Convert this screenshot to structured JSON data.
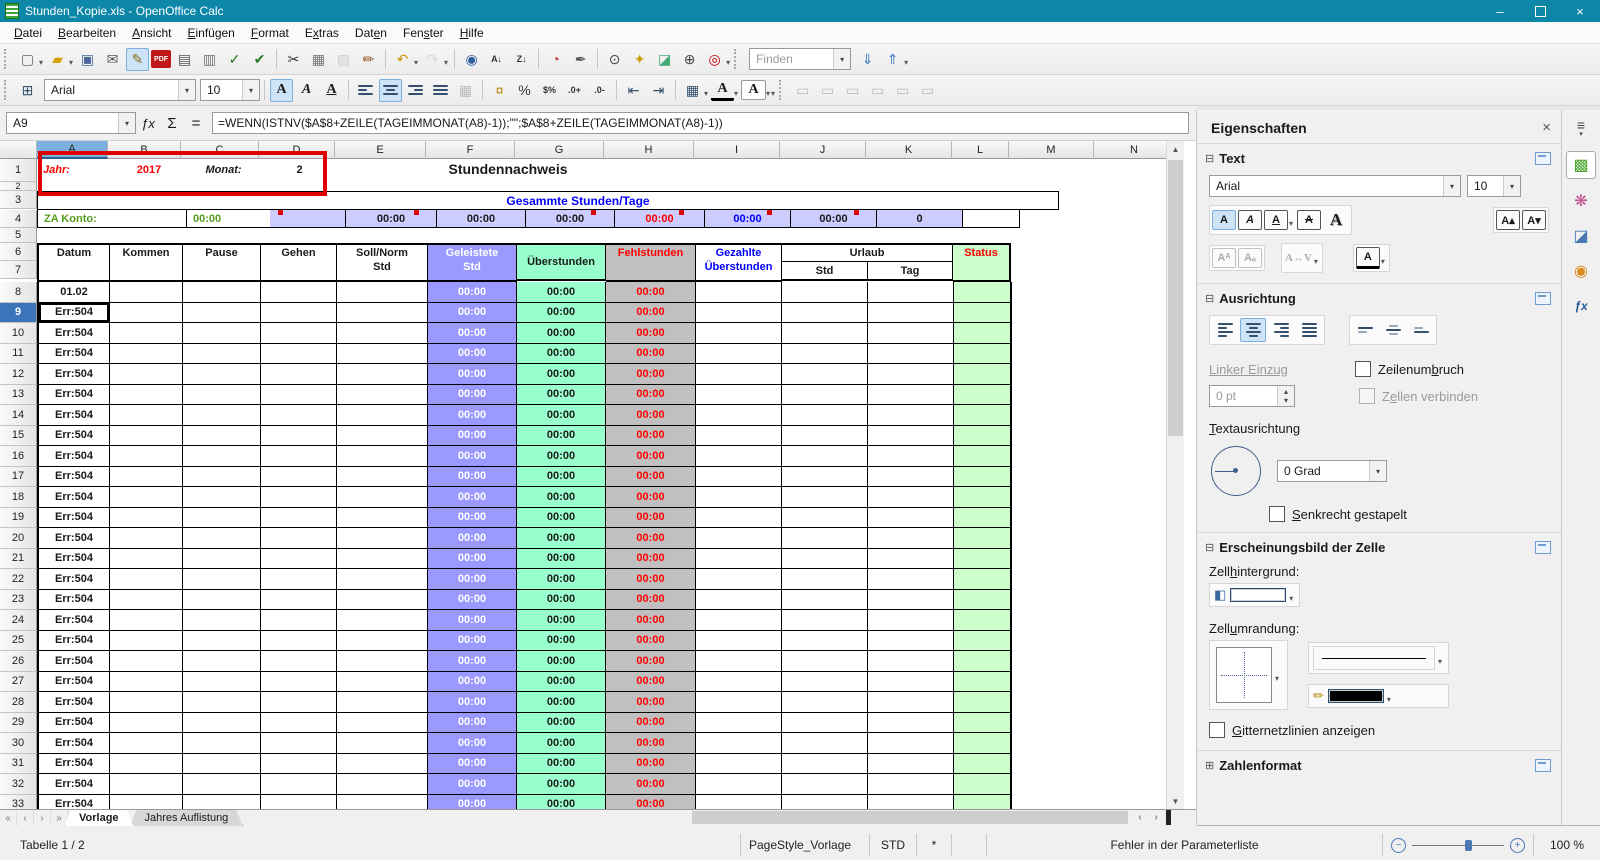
{
  "window": {
    "title": "Stunden_Kopie.xls - OpenOffice Calc"
  },
  "menubar": {
    "items": [
      {
        "label": "Datei",
        "accel": 0
      },
      {
        "label": "Bearbeiten",
        "accel": 0
      },
      {
        "label": "Ansicht",
        "accel": 0
      },
      {
        "label": "Einfügen",
        "accel": 0
      },
      {
        "label": "Format",
        "accel": 0
      },
      {
        "label": "Extras",
        "accel": 1
      },
      {
        "label": "Daten",
        "accel": 3
      },
      {
        "label": "Fenster",
        "accel": 3
      },
      {
        "label": "Hilfe",
        "accel": 0
      }
    ]
  },
  "standard_toolbar": {
    "icons": [
      {
        "name": "new-document-icon",
        "glyph": "▢",
        "color": "#666",
        "dd": true
      },
      {
        "name": "open-folder-icon",
        "glyph": "▰",
        "color": "#d9a00a",
        "dd": true
      },
      {
        "name": "save-icon",
        "glyph": "▣",
        "color": "#46689a"
      },
      {
        "name": "email-icon",
        "glyph": "✉",
        "color": "#555"
      },
      {
        "name": "edit-mode-icon",
        "glyph": "✎",
        "color": "#8a6d1a",
        "active": true
      },
      {
        "name": "export-pdf-icon",
        "glyph": "PDF",
        "color": "#fff",
        "pdf": true
      },
      {
        "name": "print-icon",
        "glyph": "▤",
        "color": "#555"
      },
      {
        "name": "print-preview-icon",
        "glyph": "▥",
        "color": "#777"
      },
      {
        "name": "spellcheck-icon",
        "glyph": "✓",
        "color": "#1f7a1f"
      },
      {
        "name": "auto-spellcheck-icon",
        "glyph": "✔",
        "color": "#1f7a1f"
      },
      {
        "name": "sep"
      },
      {
        "name": "cut-icon",
        "glyph": "✂",
        "color": "#333"
      },
      {
        "name": "copy-icon",
        "glyph": "▦",
        "color": "#777"
      },
      {
        "name": "paste-icon",
        "glyph": "▧",
        "color": "#999",
        "disabled": true
      },
      {
        "name": "format-paintbrush-icon",
        "glyph": "✏",
        "color": "#8a4a1a"
      },
      {
        "name": "sep"
      },
      {
        "name": "undo-icon",
        "glyph": "↶",
        "color": "#c89600",
        "dd": true
      },
      {
        "name": "redo-icon",
        "glyph": "↷",
        "color": "#aaa",
        "dd": true,
        "disabled": true
      },
      {
        "name": "sep"
      },
      {
        "name": "hyperlink-icon",
        "glyph": "◉",
        "color": "#2e5f9e"
      },
      {
        "name": "sort-ascending-icon",
        "glyph": "A↓",
        "color": "#333",
        "small": true
      },
      {
        "name": "sort-descending-icon",
        "glyph": "Z↓",
        "color": "#333",
        "small": true
      },
      {
        "name": "sep"
      },
      {
        "name": "insert-chart-icon",
        "glyph": "◔",
        "color": "#c03030"
      },
      {
        "name": "draw-functions-icon",
        "glyph": "✒",
        "color": "#555"
      },
      {
        "name": "sep"
      },
      {
        "name": "find-replace-icon",
        "glyph": "⊙",
        "color": "#444"
      },
      {
        "name": "navigator-icon",
        "glyph": "✦",
        "color": "#c2a200"
      },
      {
        "name": "gallery-icon",
        "glyph": "◪",
        "color": "#44aa77"
      },
      {
        "name": "zoom-icon",
        "glyph": "⊕",
        "color": "#444"
      },
      {
        "name": "help-icon",
        "glyph": "◎",
        "color": "#c00000"
      }
    ],
    "find": {
      "placeholder": "Finden",
      "down_glyph": "⇓",
      "up_glyph": "⇑"
    }
  },
  "formatting_toolbar": {
    "font_name": "Arial",
    "font_size": "10",
    "bold_label": "A",
    "italic_label": "A",
    "underline_label": "A",
    "number_icons": [
      {
        "name": "currency-format-icon",
        "glyph": "¤",
        "color": "#b8860b"
      },
      {
        "name": "percent-format-icon",
        "glyph": "%",
        "color": "#333"
      },
      {
        "name": "standard-format-icon",
        "glyph": "$%",
        "color": "#333",
        "small": true
      },
      {
        "name": "add-decimal-icon",
        "glyph": ".0+",
        "color": "#333",
        "small": true
      },
      {
        "name": "delete-decimal-icon",
        "glyph": ".0-",
        "color": "#333",
        "small": true
      }
    ],
    "indent_icons": [
      {
        "name": "decrease-indent-icon",
        "glyph": "⇤",
        "color": "#35506e"
      },
      {
        "name": "increase-indent-icon",
        "glyph": "⇥",
        "color": "#35506e"
      }
    ]
  },
  "formula_bar": {
    "cell_ref": "A9",
    "fx_label": "ƒx",
    "sum_label": "Σ",
    "equals_label": "=",
    "formula": "=WENN(ISTNV($A$8+ZEILE(TAGEIMMONAT(A8)-1));\"\";$A$8+ZEILE(TAGEIMMONAT(A8)-1))"
  },
  "sheet": {
    "columns": [
      "A",
      "B",
      "C",
      "D",
      "E",
      "F",
      "G",
      "H",
      "I",
      "J",
      "K",
      "L",
      "M",
      "N"
    ],
    "active_column": "A",
    "active_row": 9,
    "row1": {
      "jahr_label": "Jahr:",
      "jahr_value": "2017",
      "monat_label": "Monat:",
      "monat_value": "2"
    },
    "title": "Stundennachweis",
    "summary_title": "Gesammte Stunden/Tage",
    "summary_row": {
      "label": "ZA Konto:",
      "value": "00:00",
      "e": "00:00",
      "f": "00:00",
      "g": "00:00",
      "h": "00:00",
      "i": "00:00",
      "j": "00:00",
      "k": "0"
    },
    "header": {
      "datum": "Datum",
      "kommen": "Kommen",
      "pause": "Pause",
      "gehen": "Gehen",
      "soll": [
        "Soll/Norm",
        "Std"
      ],
      "geleistete": [
        "Geleistete",
        "Std"
      ],
      "ueberstunden": "Überstunden",
      "fehlstunden": "Fehlstunden",
      "gezahlte": [
        "Gezahlte",
        "Überstunden"
      ],
      "urlaub": "Urlaub",
      "urlaub_std": "Std",
      "urlaub_tag": "Tag",
      "status": "Status"
    },
    "first_data_cell": "01.02",
    "error_value": "Err:504",
    "time_value": "00:00",
    "data_rows": {
      "start": 8,
      "end": 35
    }
  },
  "tabs": {
    "sheets": [
      {
        "label": "Vorlage",
        "active": true
      },
      {
        "label": "Jahres Auflistung",
        "active": false
      }
    ]
  },
  "statusbar": {
    "sheet_info": "Tabelle 1 / 2",
    "page_style": "PageStyle_Vorlage",
    "mode": "STD",
    "modified": "*",
    "message": "Fehler in der Parameterliste",
    "zoom_level": "100 %"
  },
  "sidebar": {
    "title": "Eigenschaften",
    "text_section": {
      "title": "Text",
      "font_name": "Arial",
      "font_size": "10"
    },
    "align_section": {
      "title": "Ausrichtung",
      "indent": {
        "label": "Linker Einzug",
        "accel": 0
      },
      "indent_value": "0 pt",
      "wrap": {
        "label": "Zeilenumbruch",
        "accel": 8
      },
      "merge": {
        "label": "Zellen verbinden",
        "accel": 1
      },
      "orient": {
        "label": "Textausrichtung",
        "accel": 0
      },
      "degree_value": "0 Grad",
      "stacked": {
        "label": "Senkrecht gestapelt",
        "accel": 0
      }
    },
    "cell_section": {
      "title": "Erscheinungsbild der Zelle",
      "bg": {
        "label": "Zellhintergrund:",
        "accel": 4
      },
      "border": {
        "label": "Zellumrandung:",
        "accel": 4
      },
      "grid": {
        "label": "Gitternetzlinien anzeigen",
        "accel": 0
      }
    },
    "number_section": {
      "title": "Zahlenformat"
    },
    "tabs": [
      {
        "name": "sidebar-menu-icon",
        "glyph": "≡",
        "color": "#444"
      },
      {
        "name": "properties-tab-icon",
        "glyph": "▩",
        "color": "#4aa32a",
        "active": true
      },
      {
        "name": "styles-tab-icon",
        "glyph": "❋",
        "color": "#c04a90"
      },
      {
        "name": "gallery-tab-icon",
        "glyph": "◪",
        "color": "#4a7ab5"
      },
      {
        "name": "navigator-tab-icon",
        "glyph": "◉",
        "color": "#d88a1a"
      },
      {
        "name": "functions-tab-icon",
        "glyph": "ƒx",
        "color": "#2a5a9a",
        "small": true
      }
    ]
  }
}
